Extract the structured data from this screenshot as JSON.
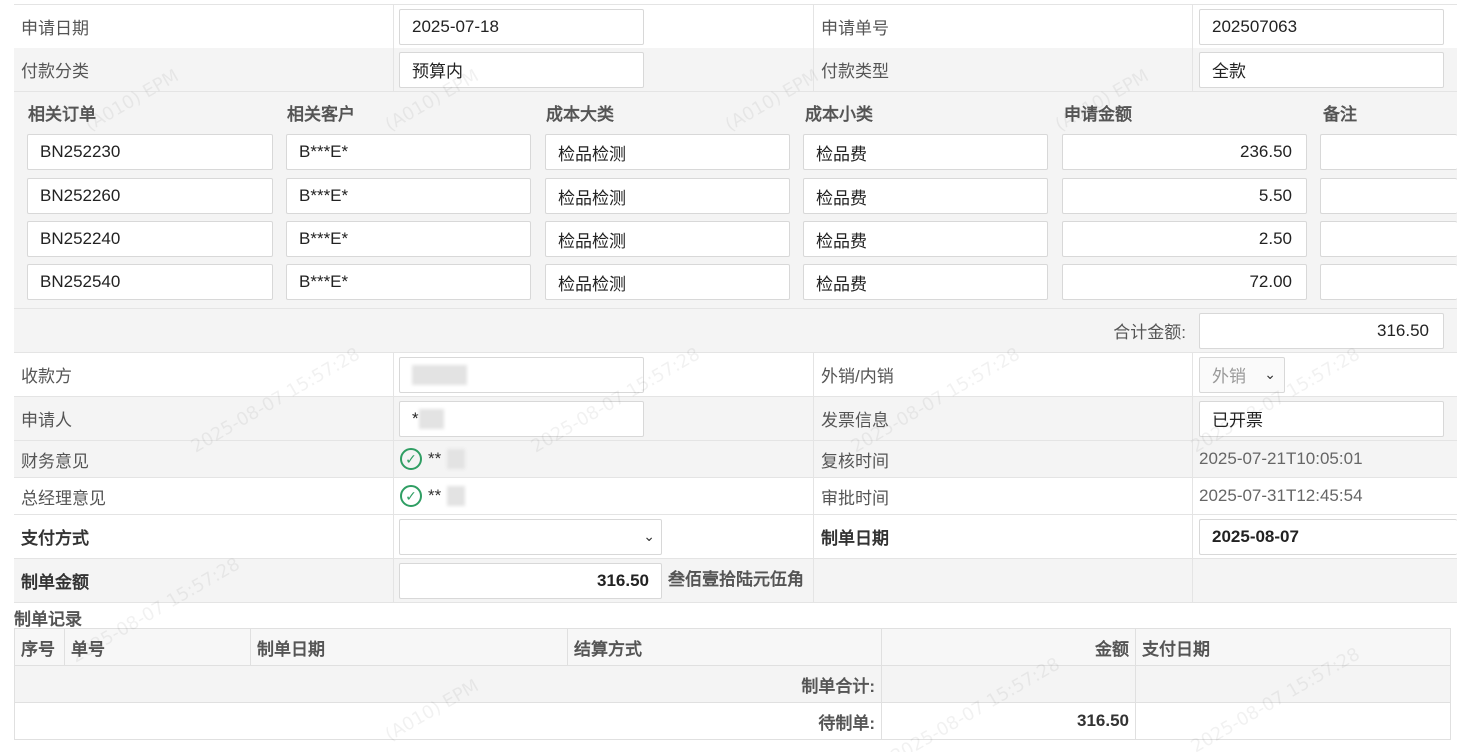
{
  "form": {
    "apply_date_label": "申请日期",
    "apply_date_value": "2025-07-18",
    "apply_no_label": "申请单号",
    "apply_no_value": "202507063",
    "pay_category_label": "付款分类",
    "pay_category_value": "预算内",
    "pay_type_label": "付款类型",
    "pay_type_value": "全款"
  },
  "detail": {
    "headers": [
      "相关订单",
      "相关客户",
      "成本大类",
      "成本小类",
      "申请金额",
      "备注"
    ],
    "rows": [
      {
        "order": "BN252230",
        "customer": "B***E*",
        "major": "检品检测",
        "minor": "检品费",
        "amount": "236.50",
        "note": ""
      },
      {
        "order": "BN252260",
        "customer": "B***E*",
        "major": "检品检测",
        "minor": "检品费",
        "amount": "5.50",
        "note": ""
      },
      {
        "order": "BN252240",
        "customer": "B***E*",
        "major": "检品检测",
        "minor": "检品费",
        "amount": "2.50",
        "note": ""
      },
      {
        "order": "BN252540",
        "customer": "B***E*",
        "major": "检品检测",
        "minor": "检品费",
        "amount": "72.00",
        "note": ""
      }
    ],
    "total_label": "合计金额:",
    "total_value": "316.50"
  },
  "info": {
    "payee_label": "收款方",
    "sales_type_label": "外销/内销",
    "sales_type_value": "外销",
    "applicant_label": "申请人",
    "applicant_value": "*",
    "invoice_label": "发票信息",
    "invoice_value": "已开票",
    "finance_label": "财务意见",
    "finance_value": "**",
    "review_time_label": "复核时间",
    "review_time_value": "2025-07-21T10:05:01",
    "gm_label": "总经理意见",
    "gm_value": "**",
    "approve_time_label": "审批时间",
    "approve_time_value": "2025-07-31T12:45:54",
    "pay_method_label": "支付方式",
    "pay_method_value": "",
    "bill_date_label": "制单日期",
    "bill_date_value": "2025-08-07",
    "bill_amount_label": "制单金额",
    "bill_amount_value": "316.50",
    "bill_amount_words": "叁佰壹拾陆元伍角"
  },
  "records": {
    "title": "制单记录",
    "headers": [
      "序号",
      "单号",
      "制单日期",
      "结算方式",
      "金额",
      "支付日期"
    ],
    "subtotal_label": "制单合计:",
    "subtotal_value": "",
    "pending_label": "待制单:",
    "pending_value": "316.50"
  },
  "watermark": {
    "text_a": "(A010) EPM",
    "text_b": "2025-08-07 15:57:28"
  },
  "colors": {
    "check_green": "#2f9e63",
    "row_alt": "#f4f4f4",
    "border": "#e4e4e4"
  }
}
